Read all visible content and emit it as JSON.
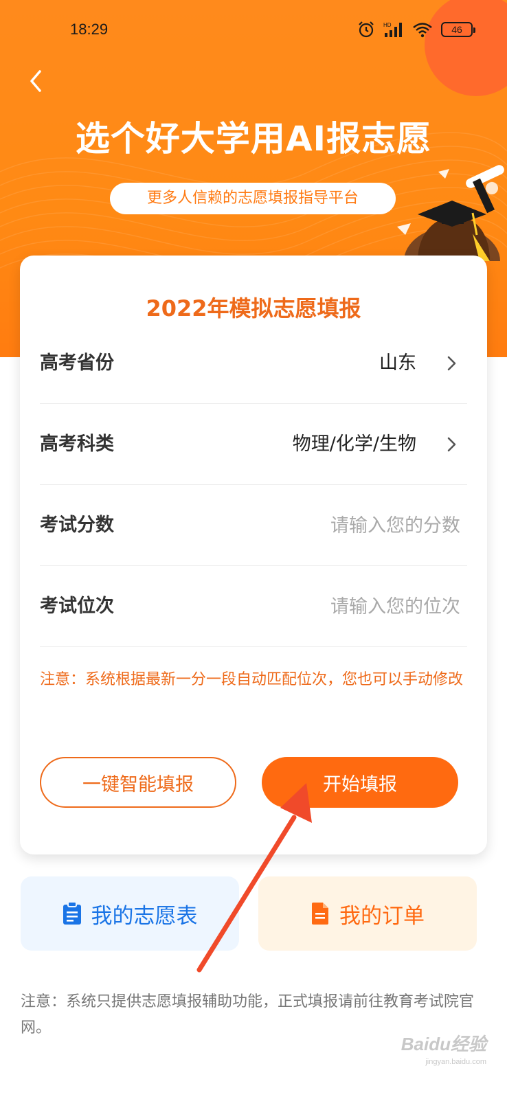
{
  "status_bar": {
    "time": "18:29",
    "battery": "46",
    "icons": [
      "alarm-icon",
      "signal-icon",
      "wifi-icon",
      "battery-icon"
    ]
  },
  "header": {
    "back_icon": "chevron-left-icon",
    "title": "选个好大学用AI报志愿",
    "subtitle": "更多人信赖的志愿填报指导平台"
  },
  "form": {
    "title": "2022年模拟志愿填报",
    "rows": [
      {
        "label": "高考省份",
        "value": "山东"
      },
      {
        "label": "高考科类",
        "value": "物理/化学/生物"
      },
      {
        "label": "考试分数",
        "placeholder": "请输入您的分数"
      },
      {
        "label": "考试位次",
        "placeholder": "请输入您的位次"
      }
    ],
    "note": "注意：系统根据最新一分一段自动匹配位次，您也可以手动修改",
    "buttons": {
      "smart_fill": "一键智能填报",
      "start_fill": "开始填报"
    }
  },
  "tiles": {
    "my_list": "我的志愿表",
    "my_orders": "我的订单"
  },
  "footer_note": "注意：系统只提供志愿填报辅助功能，正式填报请前往教育考试院官网。",
  "watermark": {
    "brand": "Baidu经验",
    "url": "jingyan.baidu.com"
  },
  "colors": {
    "header": "#ff8a1c",
    "accent": "#ee6a1a",
    "button_fill": "#ff6a10",
    "tile_blue_bg": "#eef6ff",
    "tile_blue_text": "#1a74e6",
    "tile_orange_bg": "#fff4e4",
    "annotation_arrow": "#f04a2a"
  }
}
